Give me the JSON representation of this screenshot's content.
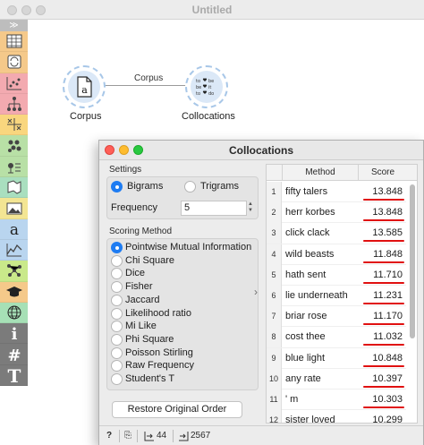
{
  "window": {
    "title": "Untitled"
  },
  "toolbox": {
    "collapse_glyph": "≫",
    "categories": [
      {
        "icon": "data-table-icon",
        "color": "#f5c98a"
      },
      {
        "icon": "transform-icon",
        "color": "#f5c98a"
      },
      {
        "icon": "scatter-plot-icon",
        "color": "#f3aab0"
      },
      {
        "icon": "tree-icon",
        "color": "#f3aab0"
      },
      {
        "icon": "model-icon",
        "color": "#f9d67e"
      },
      {
        "icon": "evaluate-icon",
        "color": "#b8e0a6"
      },
      {
        "icon": "unsupervised-icon",
        "color": "#b8e0a6"
      },
      {
        "icon": "geo-icon",
        "color": "#a9dfbf"
      },
      {
        "icon": "image-icon",
        "color": "#f3e593"
      },
      {
        "icon": "text-mining-icon",
        "color": "#b9d5ef"
      },
      {
        "icon": "timeseries-icon",
        "color": "#b9d5ef"
      },
      {
        "icon": "network-icon",
        "color": "#c9e98a"
      },
      {
        "icon": "education-icon",
        "color": "#f5c98a"
      },
      {
        "icon": "globe-icon",
        "color": "#a6e0b6"
      },
      {
        "icon": "info-icon",
        "color": "#7b7b7b"
      },
      {
        "icon": "hash-icon",
        "color": "#7b7b7b"
      },
      {
        "icon": "text-icon",
        "color": "#7b7b7b"
      }
    ],
    "category_letters": {
      "text_mining": "a",
      "info": "i",
      "hash": "#",
      "text": "T"
    }
  },
  "canvas": {
    "link_label": "Corpus",
    "nodes": [
      {
        "label": "Corpus",
        "icon": "corpus-icon"
      },
      {
        "label": "Collocations",
        "icon": "collocations-icon"
      }
    ]
  },
  "dialog": {
    "title": "Collocations",
    "settings": {
      "heading": "Settings",
      "options": [
        "Bigrams",
        "Trigrams"
      ],
      "selected": "Bigrams",
      "frequency_label": "Frequency",
      "frequency_value": "5"
    },
    "scoring": {
      "heading": "Scoring Method",
      "options": [
        "Pointwise Mutual Information",
        "Chi Square",
        "Dice",
        "Fisher",
        "Jaccard",
        "Likelihood ratio",
        "Mi Like",
        "Phi Square",
        "Poisson Stirling",
        "Raw Frequency",
        "Student's T"
      ],
      "selected": "Pointwise Mutual Information"
    },
    "restore_button": "Restore Original Order",
    "table": {
      "columns": [
        "Method",
        "Score"
      ],
      "rows": [
        {
          "idx": "1",
          "method": "fifty talers",
          "score": "13.848"
        },
        {
          "idx": "2",
          "method": "herr korbes",
          "score": "13.848"
        },
        {
          "idx": "3",
          "method": "click clack",
          "score": "13.585"
        },
        {
          "idx": "4",
          "method": "wild beasts",
          "score": "11.848"
        },
        {
          "idx": "5",
          "method": "hath sent",
          "score": "11.710"
        },
        {
          "idx": "6",
          "method": "lie underneath",
          "score": "11.231"
        },
        {
          "idx": "7",
          "method": "briar rose",
          "score": "11.170"
        },
        {
          "idx": "8",
          "method": "cost thee",
          "score": "11.032"
        },
        {
          "idx": "9",
          "method": "blue light",
          "score": "10.848"
        },
        {
          "idx": "10",
          "method": "any rate",
          "score": "10.397"
        },
        {
          "idx": "11",
          "method": "' m",
          "score": "10.303"
        },
        {
          "idx": "12",
          "method": "sister loved",
          "score": "10.299"
        }
      ]
    },
    "status": {
      "help": "?",
      "report": "⎘",
      "input_count": "44",
      "output_count": "2567"
    }
  }
}
